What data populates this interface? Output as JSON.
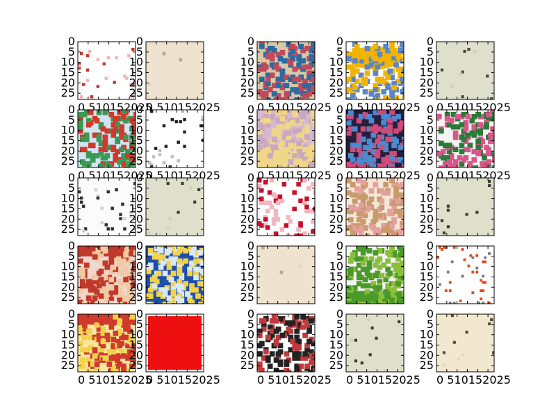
{
  "chart_data": {
    "type": "image_grid",
    "rows": 5,
    "cols": 5,
    "image_size": [
      28,
      28
    ],
    "xticks": [
      0,
      5,
      10,
      15,
      20,
      25
    ],
    "yticks": [
      0,
      5,
      10,
      15,
      20,
      25
    ],
    "xtick_labels": [
      "0",
      "5",
      "10",
      "15",
      "20",
      "25"
    ],
    "ytick_labels": [
      "0",
      "5",
      "10",
      "15",
      "20",
      "25"
    ],
    "tiles": [
      {
        "style": "sparse",
        "bg": "#ffffff",
        "ink": "#c0392b",
        "accent": "#f2b3b3"
      },
      {
        "style": "plain",
        "bg": "#efe3cf",
        "ink": "#b8a88c",
        "accent": "#e2d4bc"
      },
      {
        "style": "colorful",
        "bg": "#d8c8a8",
        "ink": "#2c6aa0",
        "accent": "#c04a5a"
      },
      {
        "style": "banner",
        "bg": "#ffffff",
        "ink": "#f2b400",
        "accent": "#5a86c8"
      },
      {
        "style": "dots",
        "bg": "#dedfcc",
        "ink": "#4a4a3a",
        "accent": "#cfd0bb"
      },
      {
        "style": "colorful",
        "bg": "#cfe6f2",
        "ink": "#d0392b",
        "accent": "#3a9a55"
      },
      {
        "style": "sparse",
        "bg": "#ffffff",
        "ink": "#222222",
        "accent": "#bdbdbd"
      },
      {
        "style": "split",
        "bg": "#d7b9cf",
        "ink": "#efd68a",
        "accent": "#c9a8c0"
      },
      {
        "style": "dark",
        "bg": "#26203e",
        "ink": "#d04a7a",
        "accent": "#4a8ad0"
      },
      {
        "style": "portrait",
        "bg": "#f4f4f4",
        "ink": "#d8568a",
        "accent": "#2a7a3a"
      },
      {
        "style": "sparse",
        "bg": "#fbfbfb",
        "ink": "#303030",
        "accent": "#cfcfcf"
      },
      {
        "style": "dots",
        "bg": "#dfdfcc",
        "ink": "#3a3a30",
        "accent": "#cfd0bb"
      },
      {
        "style": "floral",
        "bg": "#ffffff",
        "ink": "#c8102e",
        "accent": "#f3b6bf"
      },
      {
        "style": "colorful",
        "bg": "#f4e7d6",
        "ink": "#c99a6a",
        "accent": "#e4a0a0"
      },
      {
        "style": "dots",
        "bg": "#dfdfcc",
        "ink": "#3a3a30",
        "accent": "#cfd0bb"
      },
      {
        "style": "frame",
        "bg": "#f0d6cc",
        "ink": "#c0392b",
        "accent": "#f2c9a0"
      },
      {
        "style": "colorful",
        "bg": "#1f4fa8",
        "ink": "#f2d24a",
        "accent": "#d8e8f4"
      },
      {
        "style": "plain",
        "bg": "#efe3cf",
        "ink": "#b8a88c",
        "accent": "#e2d4bc"
      },
      {
        "style": "grass",
        "bg": "#f4f4f2",
        "ink": "#4a9a2a",
        "accent": "#8abf3a"
      },
      {
        "style": "text",
        "bg": "#ffffff",
        "ink": "#e04a1a",
        "accent": "#7a7a7a"
      },
      {
        "style": "frame",
        "bg": "#f8e6a0",
        "ink": "#d0392b",
        "accent": "#f2d24a"
      },
      {
        "style": "solid",
        "bg": "#ffffff",
        "ink": "#ee1010",
        "accent": "#ee1010"
      },
      {
        "style": "collage",
        "bg": "#ffffff",
        "ink": "#222222",
        "accent": "#c0393b"
      },
      {
        "style": "dots",
        "bg": "#dfdfcc",
        "ink": "#3a3a30",
        "accent": "#cfd0bb"
      },
      {
        "style": "dots",
        "bg": "#f2e7cf",
        "ink": "#5a4a30",
        "accent": "#e6d8be"
      }
    ],
    "xtick_rows_shown": [
      1,
      2,
      5
    ],
    "title": "",
    "xlabel": "",
    "ylabel": ""
  }
}
